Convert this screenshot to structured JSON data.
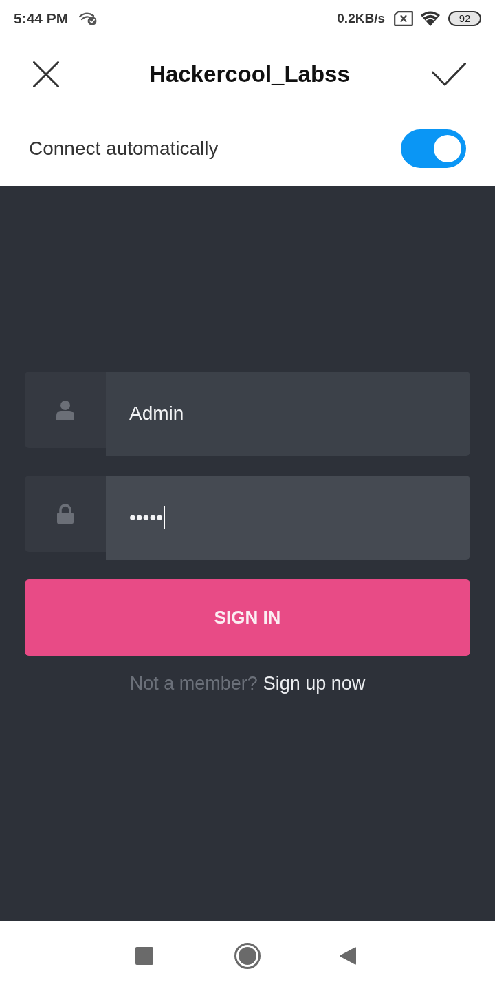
{
  "status_bar": {
    "time": "5:44 PM",
    "network_speed": "0.2KB/s",
    "battery": "92"
  },
  "header": {
    "title": "Hackercool_Labss"
  },
  "auto_connect": {
    "label": "Connect automatically",
    "on": true
  },
  "login_form": {
    "fields": [
      {
        "kind": "text",
        "value": "Admin",
        "focused": false
      },
      {
        "kind": "password",
        "value": "•••••",
        "focused": true
      }
    ],
    "submit": "SIGN IN",
    "signup_prompt": "Not a member?",
    "signup_link": "Sign up now"
  }
}
